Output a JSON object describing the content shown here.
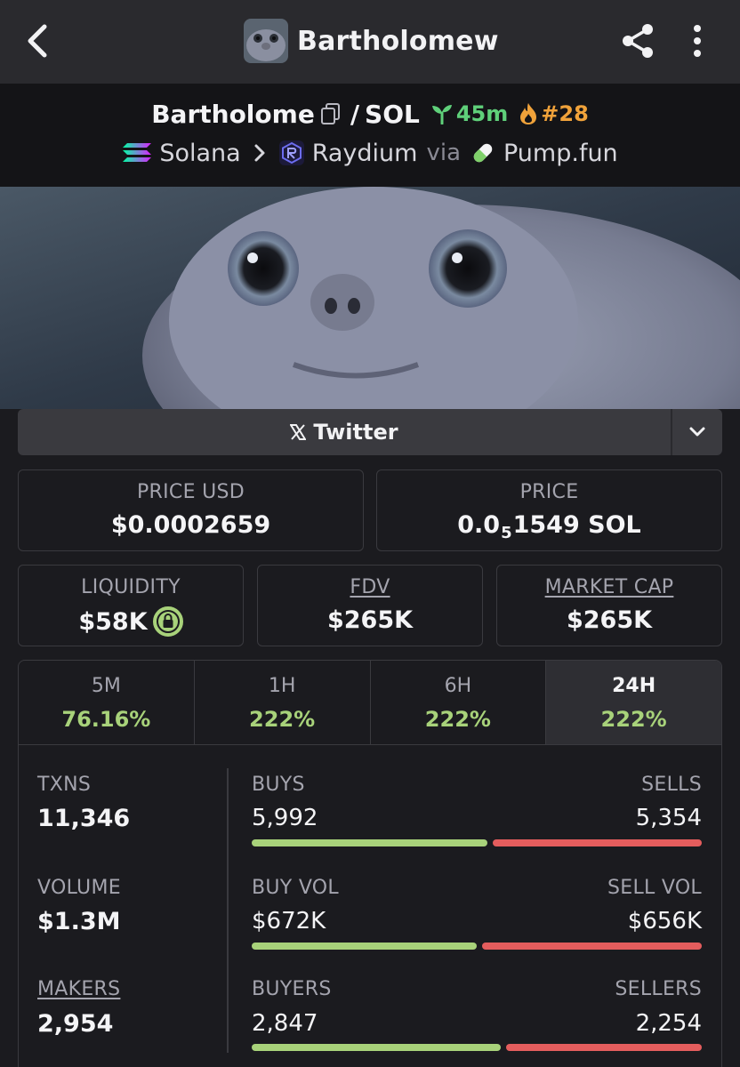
{
  "header": {
    "title": "Bartholomew",
    "icons": {
      "back": "back-arrow-icon",
      "share": "share-icon",
      "more": "more-vertical-icon"
    }
  },
  "pair": {
    "base": "Bartholome",
    "separator": "/",
    "quote": "SOL",
    "age": "45m",
    "rank": "#28",
    "chain": "Solana",
    "dex": "Raydium",
    "via": "via",
    "launchpad": "Pump.fun"
  },
  "links": {
    "twitter": "Twitter"
  },
  "price": {
    "usd_label": "PRICE USD",
    "usd_value": "$0.0002659",
    "native_label": "PRICE",
    "native_prefix": "0.0",
    "native_zeros": "5",
    "native_digits": "1549",
    "native_unit": "SOL"
  },
  "metrics": {
    "liquidity_label": "LIQUIDITY",
    "liquidity_value": "$58K",
    "fdv_label": "FDV",
    "fdv_value": "$265K",
    "mcap_label": "MARKET CAP",
    "mcap_value": "$265K"
  },
  "timeframes": [
    {
      "label": "5M",
      "change": "76.16%",
      "active": false
    },
    {
      "label": "1H",
      "change": "222%",
      "active": false
    },
    {
      "label": "6H",
      "change": "222%",
      "active": false
    },
    {
      "label": "24H",
      "change": "222%",
      "active": true
    }
  ],
  "stats": {
    "txns_label": "TXNS",
    "txns_value": "11,346",
    "volume_label": "VOLUME",
    "volume_value": "$1.3M",
    "makers_label": "MAKERS",
    "makers_value": "2,954",
    "buys_label": "BUYS",
    "buys_value": "5,992",
    "sells_label": "SELLS",
    "sells_value": "5,354",
    "buy_share": 0.53,
    "buyvol_label": "BUY VOL",
    "buyvol_value": "$672K",
    "sellvol_label": "SELL VOL",
    "sellvol_value": "$656K",
    "buyvol_share": 0.506,
    "buyers_label": "BUYERS",
    "buyers_value": "2,847",
    "sellers_label": "SELLERS",
    "sellers_value": "2,254",
    "buyers_share": 0.56
  },
  "colors": {
    "positive": "#a8d27a",
    "negative": "#e45d5d",
    "age": "#5fd07a",
    "rank": "#f0a23a"
  }
}
